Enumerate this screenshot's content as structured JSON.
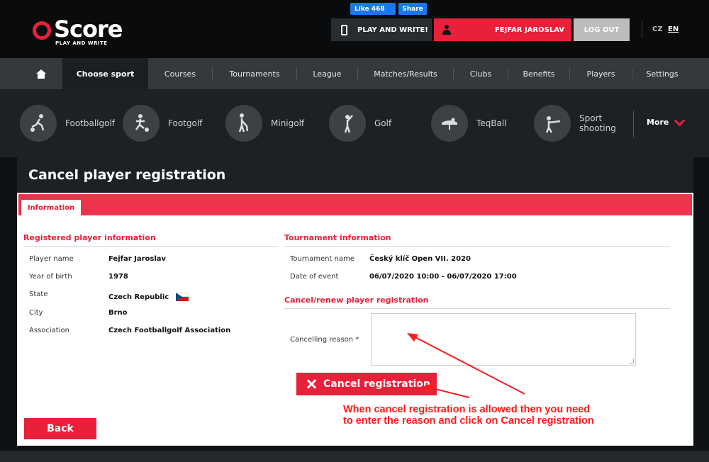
{
  "header": {
    "logo_text": "Score",
    "logo_sub": "PLAY AND WRITE",
    "fb_like": "Like 468",
    "fb_share": "Share",
    "play_write": "PLAY AND WRITE!",
    "user_name": "FEJFAR JAROSLAV",
    "logout": "LOG OUT",
    "lang_cz": "CZ",
    "lang_en": "EN"
  },
  "nav": {
    "items": [
      "Choose sport",
      "Courses",
      "Tournaments",
      "League",
      "Matches/Results",
      "Clubs",
      "Benefits",
      "Players",
      "Settings"
    ]
  },
  "sports": {
    "items": [
      "Footballgolf",
      "Footgolf",
      "Minigolf",
      "Golf",
      "TeqBall",
      "Sport",
      "shooting"
    ],
    "more": "More"
  },
  "page": {
    "title": "Cancel player registration",
    "tab": "Information"
  },
  "player": {
    "section_title": "Registered player information",
    "name_label": "Player name",
    "name_value": "Fejfar Jaroslav",
    "birth_label": "Year of birth",
    "birth_value": "1978",
    "state_label": "State",
    "state_value": "Czech Republic",
    "city_label": "City",
    "city_value": "Brno",
    "assoc_label": "Association",
    "assoc_value": "Czech Footballgolf Association"
  },
  "tournament": {
    "section_title": "Tournament information",
    "name_label": "Tournament name",
    "name_value": "Český klíč Open VII. 2020",
    "date_label": "Date of event",
    "date_value": "06/07/2020 10:00 - 06/07/2020 17:00"
  },
  "cancel": {
    "section_title": "Cancel/renew player registration",
    "reason_label": "Cancelling reason *",
    "reason_value": "",
    "button": "Cancel registration"
  },
  "back_button": "Back",
  "annotation": {
    "line1": "When cancel registration is allowed then you need",
    "line2": "to enter the reason and click on Cancel registration"
  },
  "colors": {
    "accent": "#e8203a",
    "nav_bg": "#34393d",
    "annotation": "#ff1a1a"
  },
  "icons": {
    "home": "home-icon",
    "phone": "phone-icon",
    "user": "user-icon",
    "more": "chevron-down-icon",
    "cancel": "close-icon",
    "sports": [
      "footballgolf-icon",
      "footgolf-icon",
      "minigolf-icon",
      "golf-icon",
      "teqball-icon",
      "sport-shooting-icon"
    ]
  }
}
